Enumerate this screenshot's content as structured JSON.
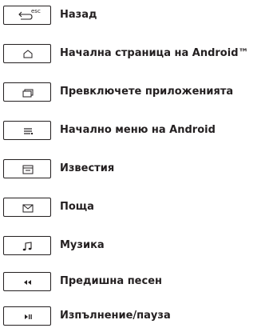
{
  "hotkeys": [
    {
      "icon": "back-esc-icon",
      "key_text": "esc",
      "label": "Назад"
    },
    {
      "icon": "home-icon",
      "key_text": "",
      "label": "Начална страница на Android™"
    },
    {
      "icon": "app-switch-icon",
      "key_text": "",
      "label": "Превключете приложенията"
    },
    {
      "icon": "menu-icon",
      "key_text": "",
      "label": "Начално меню на Android"
    },
    {
      "icon": "notifications-icon",
      "key_text": "",
      "label": "Известия"
    },
    {
      "icon": "mail-icon",
      "key_text": "",
      "label": "Поща"
    },
    {
      "icon": "music-note-icon",
      "key_text": "",
      "label": "Музика"
    },
    {
      "icon": "previous-track-icon",
      "key_text": "",
      "label": "Предишна песен"
    },
    {
      "icon": "play-pause-icon",
      "key_text": "",
      "label": "Изпълнение/пауза"
    }
  ]
}
